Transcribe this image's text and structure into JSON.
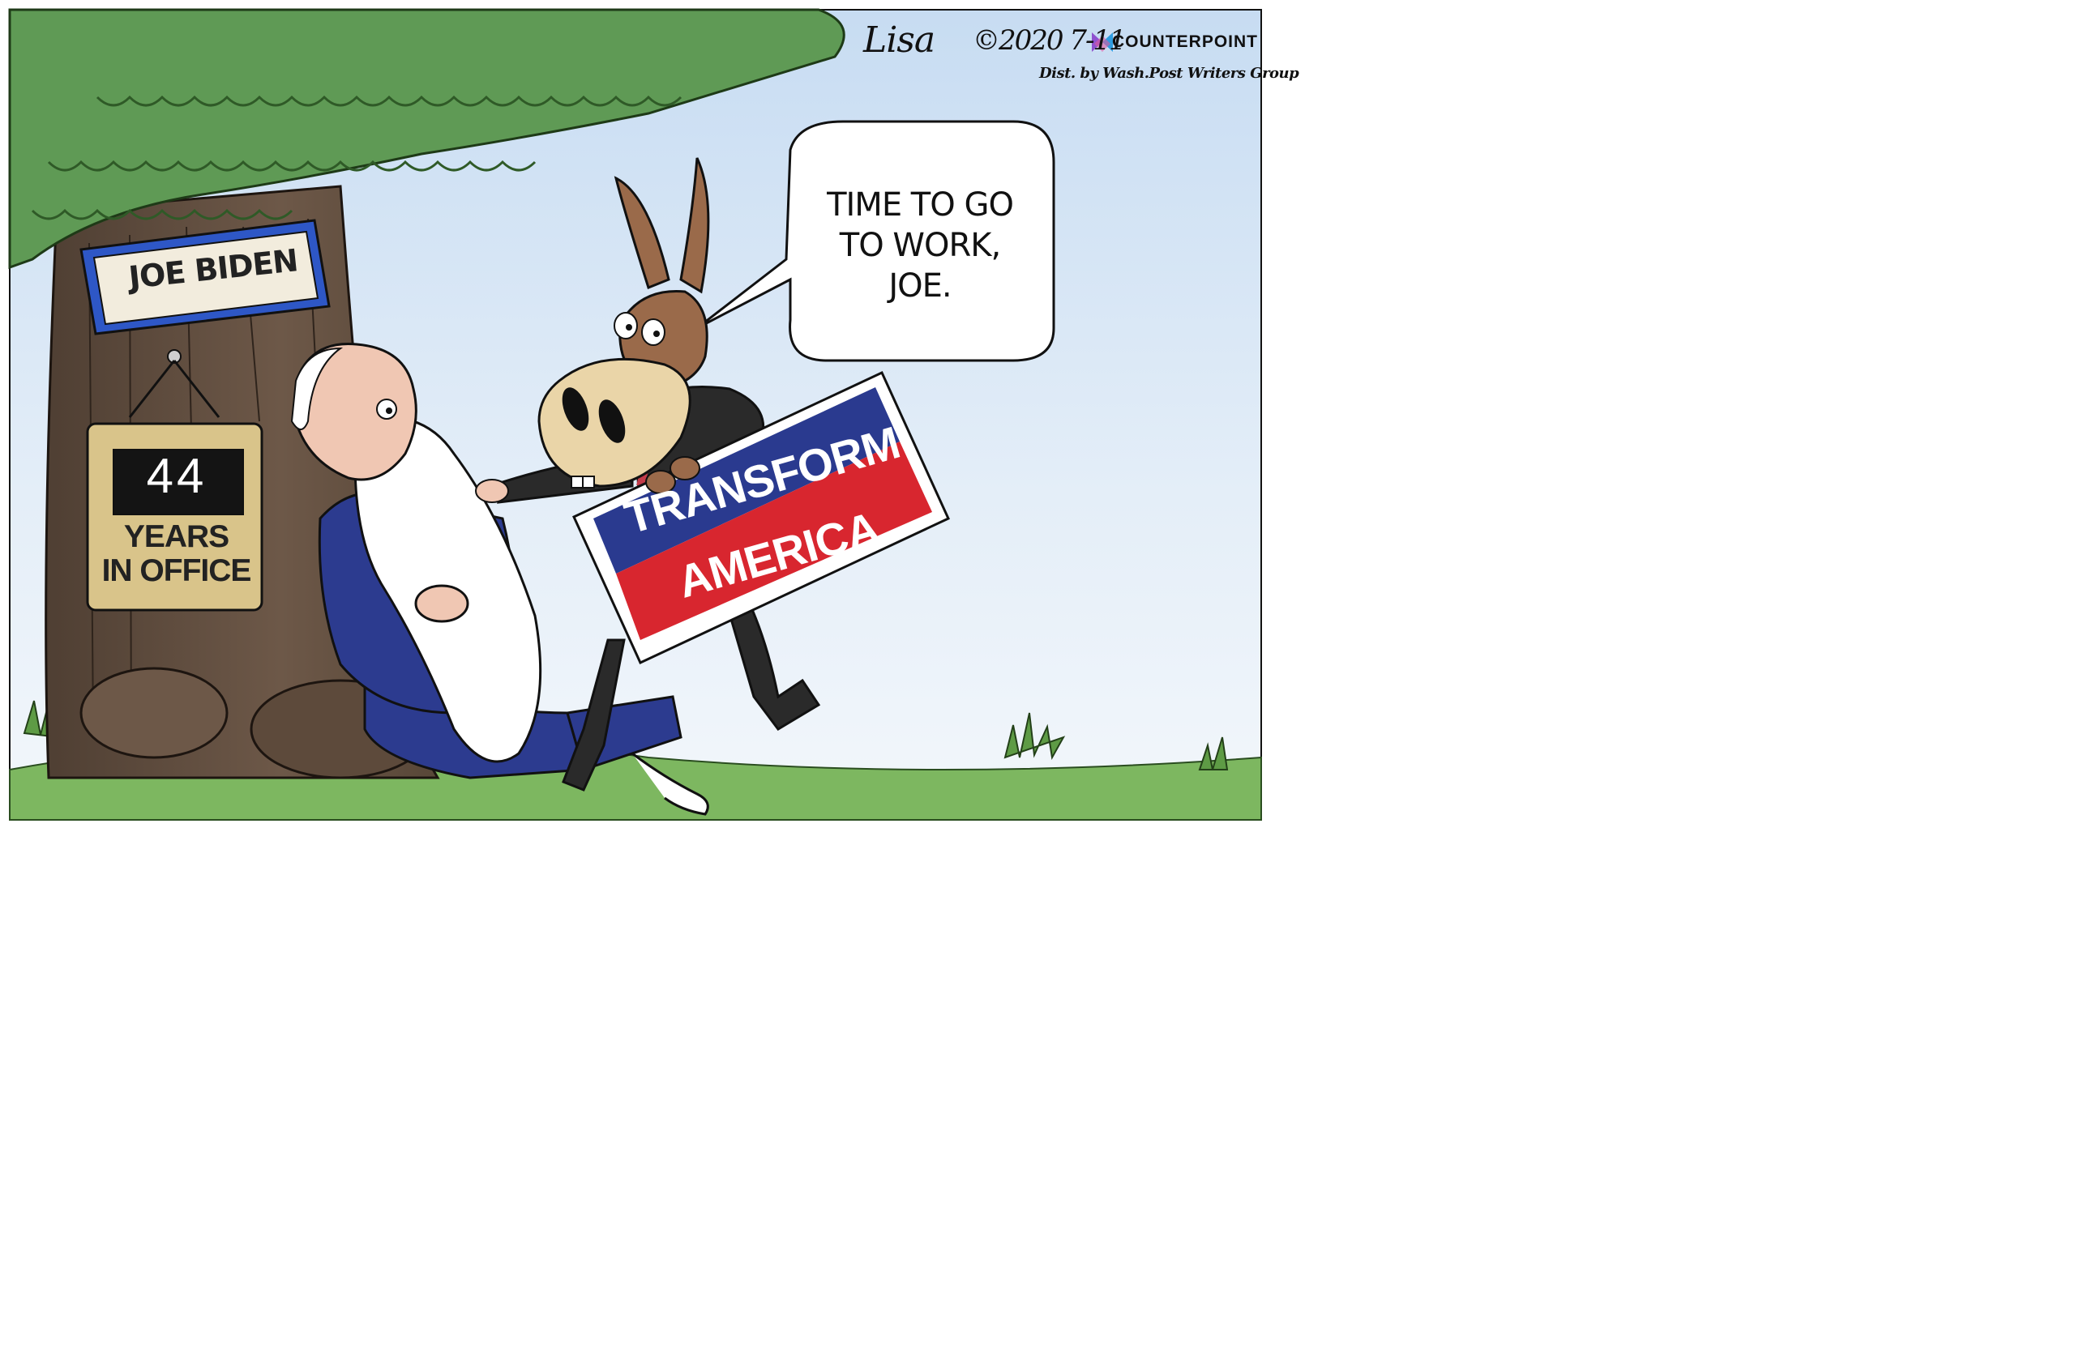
{
  "credit": {
    "signature": "Lisa",
    "date": "©2020 7-11",
    "brand": "COUNTERPOINT",
    "distribution": "Dist. by Wash.Post Writers Group"
  },
  "speech_bubble": {
    "text": "TIME TO GO\nTO WORK,\nJOE."
  },
  "name_sign": {
    "text": "JOE BIDEN"
  },
  "tenure_sign": {
    "count": "44",
    "caption": "YEARS\nIN OFFICE"
  },
  "campaign_sign": {
    "line1": "TRANSFORM",
    "line2": "AMERICA"
  },
  "colors": {
    "sky": "#d7e6f5",
    "leaves": "#5f9a55",
    "trunk": "#6a5545",
    "grass": "#7db760",
    "sign_blue": "#2a3a8f",
    "sign_red": "#d8262f",
    "name_sign_border": "#2e57c6",
    "tenure_sign_bg": "#d9c48a",
    "suit": "#2c3b8f",
    "donkey": "#9a6a4a"
  }
}
